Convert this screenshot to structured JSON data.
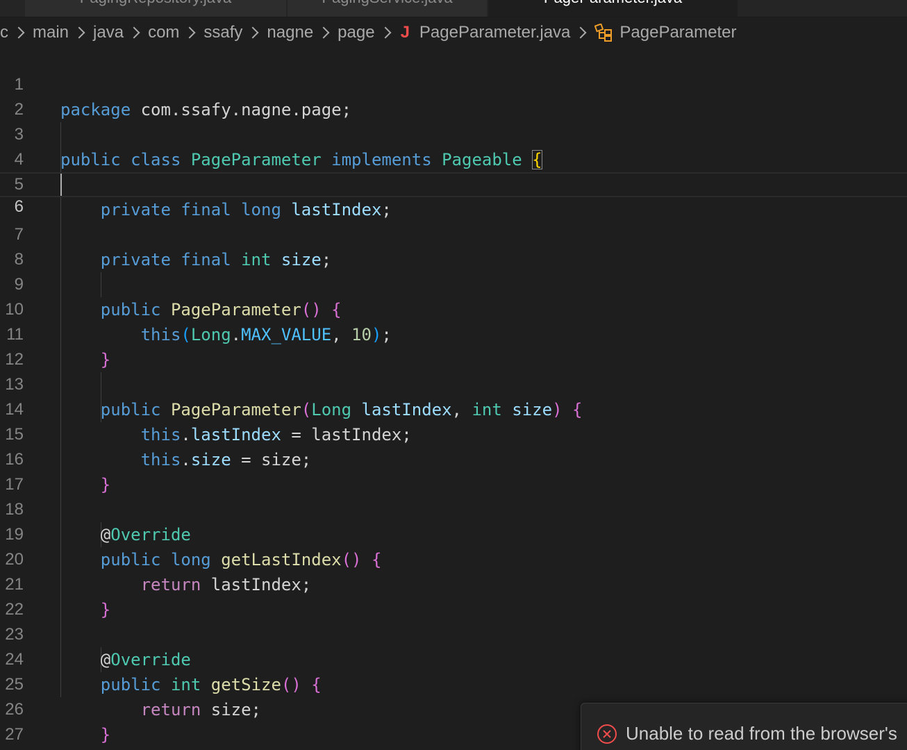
{
  "tabs": [
    {
      "label": "PagingRepository.java",
      "active": false
    },
    {
      "label": "PagingService.java",
      "active": false
    },
    {
      "label": "PageParameter.java",
      "active": true
    }
  ],
  "breadcrumb": {
    "items": [
      "rc",
      "main",
      "java",
      "com",
      "ssafy",
      "nagne",
      "page"
    ],
    "file_icon": "J",
    "file": "PageParameter.java",
    "symbol": "PageParameter"
  },
  "editor": {
    "current_line": 6,
    "lines": [
      {
        "n": "1"
      },
      {
        "n": "2"
      },
      {
        "n": "3"
      },
      {
        "n": "4"
      },
      {
        "n": "5"
      },
      {
        "n": "6"
      },
      {
        "n": "7"
      },
      {
        "n": "8"
      },
      {
        "n": "9"
      },
      {
        "n": "10"
      },
      {
        "n": "11"
      },
      {
        "n": "12"
      },
      {
        "n": "13"
      },
      {
        "n": "14"
      },
      {
        "n": "15"
      },
      {
        "n": "16"
      },
      {
        "n": "17"
      },
      {
        "n": "18"
      },
      {
        "n": "19"
      },
      {
        "n": "20"
      },
      {
        "n": "21"
      },
      {
        "n": "22"
      },
      {
        "n": "23"
      },
      {
        "n": "24"
      },
      {
        "n": "25"
      },
      {
        "n": "26"
      },
      {
        "n": "27"
      }
    ],
    "code": {
      "package": "package",
      "package_name": "com.ssafy.nagne.page",
      "public": "public",
      "class": "class",
      "class_name": "PageParameter",
      "implements": "implements",
      "interface": "Pageable",
      "private": "private",
      "final": "final",
      "long": "long",
      "int": "int",
      "Long": "Long",
      "lastIndex": "lastIndex",
      "size": "size",
      "this": "this",
      "max_value": "MAX_VALUE",
      "ten": "10",
      "override": "Override",
      "getLastIndex": "getLastIndex",
      "getSize": "getSize",
      "return": "return"
    }
  },
  "notification": {
    "message": "Unable to read from the browser's",
    "icon": "error-circle-icon"
  },
  "colors": {
    "background": "#1e1e1e",
    "keyword": "#569cd6",
    "type": "#4ec9b0",
    "function": "#dcdcaa",
    "variable": "#9cdcfe",
    "control": "#c586c0",
    "error": "#f14c4c"
  }
}
